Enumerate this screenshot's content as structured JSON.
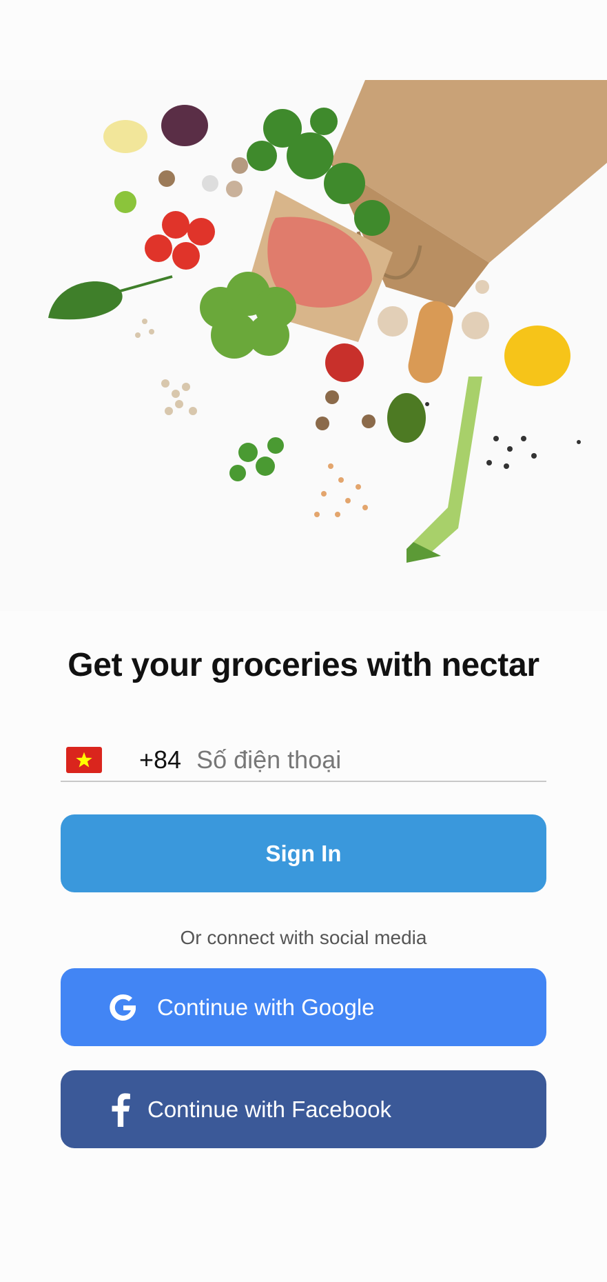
{
  "hero": {
    "image": "groceries-bag-spill-illustration"
  },
  "title": "Get your groceries with nectar",
  "phone": {
    "country_flag": "vietnam-flag-icon",
    "country_code": "+84",
    "placeholder": "Số điện thoại",
    "value": ""
  },
  "buttons": {
    "sign_in": "Sign In",
    "google": "Continue with Google",
    "facebook": "Continue with Facebook"
  },
  "or_text": "Or connect with social media",
  "colors": {
    "sign_in": "#3a98dc",
    "google": "#4285f4",
    "facebook": "#3b5998",
    "flag_red": "#da251d",
    "flag_star": "#ffff00"
  }
}
